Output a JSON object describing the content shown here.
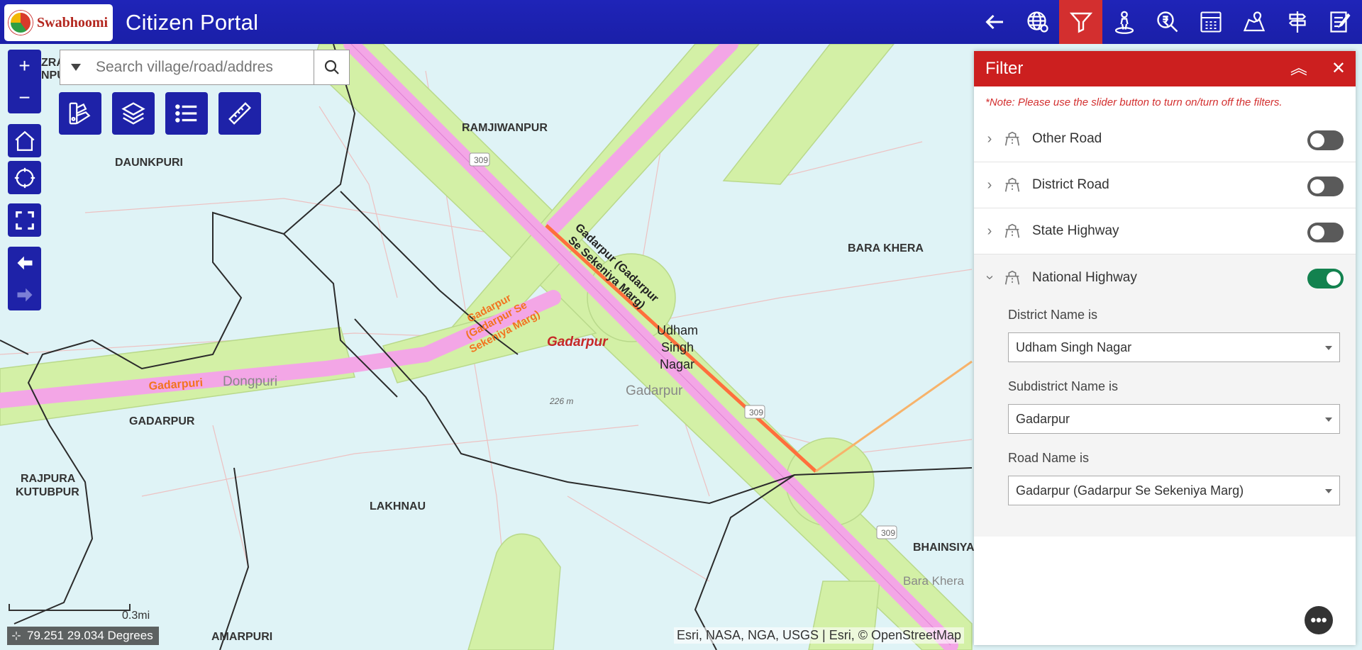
{
  "header": {
    "logo_text": "Swabhoomi",
    "title": "Citizen Portal",
    "toolbar": [
      {
        "name": "back-arrow-icon"
      },
      {
        "name": "globe-icon"
      },
      {
        "name": "filter-icon",
        "active": true
      },
      {
        "name": "location-person-icon"
      },
      {
        "name": "rupee-search-icon"
      },
      {
        "name": "calculator-icon"
      },
      {
        "name": "map-pin-icon"
      },
      {
        "name": "signpost-icon"
      },
      {
        "name": "edit-note-icon"
      }
    ]
  },
  "map": {
    "search_placeholder": "Search village/road/addres",
    "places": {
      "ramjiwanpur": "RAMJIWANPUR",
      "daunkpuri": "DAUNKPURI",
      "bara_khera": "BARA KHERA",
      "udham": "Udham",
      "singh": "Singh",
      "nagar": "Nagar",
      "gadarpur_red": "Gadarpur",
      "gadarpur_light": "Gadarpur",
      "gadarpur_caps": "GADARPUR",
      "rajpura": "RAJPURA",
      "kutubpur": "KUTUBPUR",
      "lakhnau": "LAKHNAU",
      "bhainsiya": "BHAINSIYA",
      "bara_khera_light": "Bara Khera",
      "amarpuri": "AMARPURI",
      "dongpuri": "Dongpuri",
      "gadarpuri_orange": "Gadarpuri",
      "zra": "ZRA",
      "npu": "NPU",
      "road_label_1": "Gadarpur (Gadarpur",
      "road_label_2": "Se Sekeniya Marg)",
      "road_orange_1": "Gadarpur",
      "road_orange_2": "(Gadarpur Se",
      "road_orange_3": "Sekeniya Marg)",
      "elevation": "226 m",
      "hw_309": "309"
    },
    "scale_label": "0.3mi",
    "coordinates": "79.251 29.034 Degrees",
    "attribution": "Esri, NASA, NGA, USGS | Esri, © OpenStreetMap"
  },
  "panel": {
    "title": "Filter",
    "note": "*Note: Please use the slider button to turn on/turn off the filters.",
    "rows": [
      {
        "label": "Other Road",
        "on": false
      },
      {
        "label": "District Road",
        "on": false
      },
      {
        "label": "State Highway",
        "on": false
      },
      {
        "label": "National Highway",
        "on": true
      }
    ],
    "fields": [
      {
        "label": "District Name is",
        "value": "Udham Singh Nagar"
      },
      {
        "label": "Subdistrict Name is",
        "value": "Gadarpur"
      },
      {
        "label": "Road Name is",
        "value": "Gadarpur (Gadarpur Se Sekeniya Marg)"
      }
    ]
  },
  "colors": {
    "header_bg": "#1f24b8",
    "active_tool": "#d32f2f",
    "panel_header": "#cc1f1f",
    "toggle_on": "#13824f",
    "toggle_off": "#5a5a5a",
    "highway_pink": "#f3a6e6",
    "highway_green": "#d3f0a6",
    "selected_road": "#ff6f3c"
  }
}
